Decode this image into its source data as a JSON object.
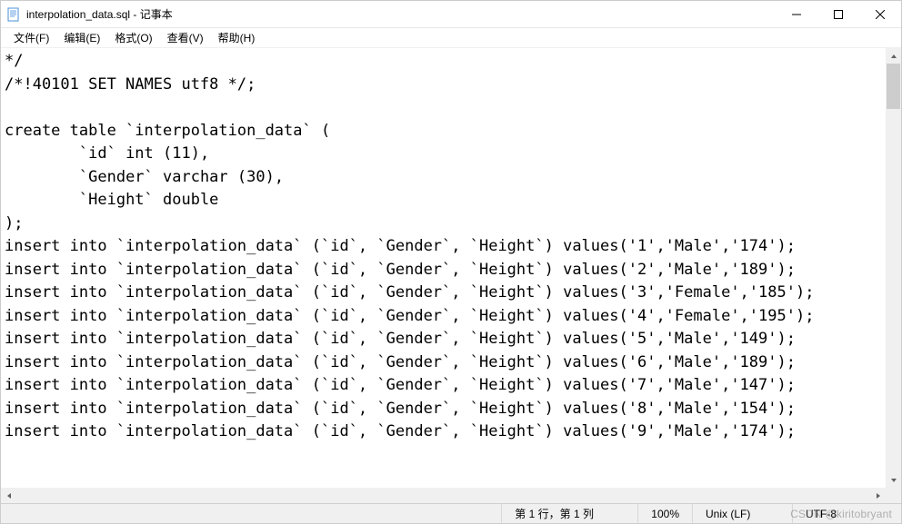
{
  "window": {
    "title": "interpolation_data.sql - 记事本"
  },
  "menu": {
    "file": "文件(F)",
    "edit": "编辑(E)",
    "format": "格式(O)",
    "view": "查看(V)",
    "help": "帮助(H)"
  },
  "editor": {
    "content": "*/\n/*!40101 SET NAMES utf8 */;\n\ncreate table `interpolation_data` (\n\t`id` int (11),\n\t`Gender` varchar (30),\n\t`Height` double\n);\ninsert into `interpolation_data` (`id`, `Gender`, `Height`) values('1','Male','174');\ninsert into `interpolation_data` (`id`, `Gender`, `Height`) values('2','Male','189');\ninsert into `interpolation_data` (`id`, `Gender`, `Height`) values('3','Female','185');\ninsert into `interpolation_data` (`id`, `Gender`, `Height`) values('4','Female','195');\ninsert into `interpolation_data` (`id`, `Gender`, `Height`) values('5','Male','149');\ninsert into `interpolation_data` (`id`, `Gender`, `Height`) values('6','Male','189');\ninsert into `interpolation_data` (`id`, `Gender`, `Height`) values('7','Male','147');\ninsert into `interpolation_data` (`id`, `Gender`, `Height`) values('8','Male','154');\ninsert into `interpolation_data` (`id`, `Gender`, `Height`) values('9','Male','174');"
  },
  "status": {
    "position": "第 1 行，第 1 列",
    "zoom": "100%",
    "line_ending": "Unix (LF)",
    "encoding": "UTF-8"
  },
  "watermark": "CSDN @kiritobryant"
}
